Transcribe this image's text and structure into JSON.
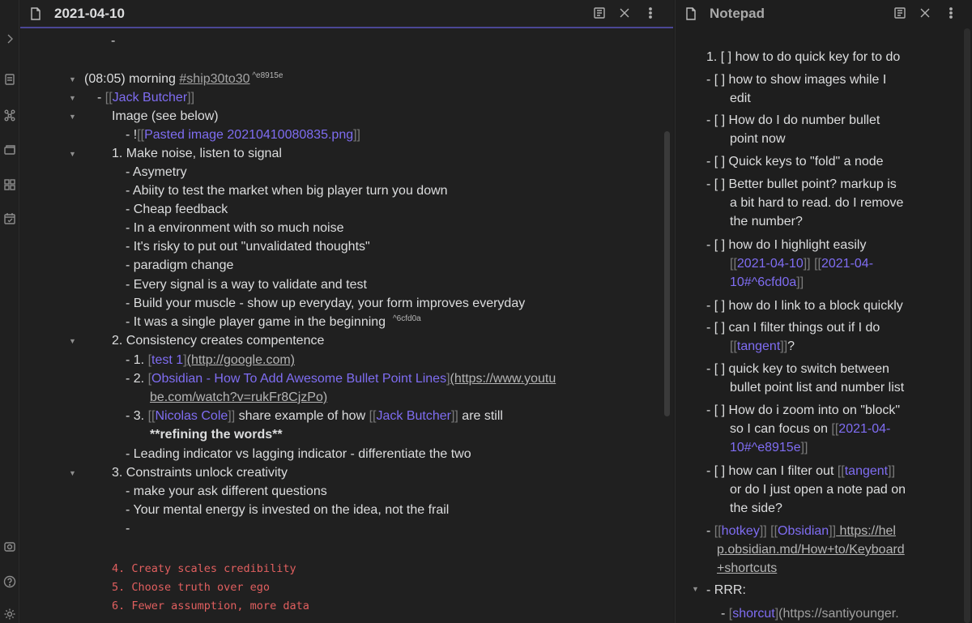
{
  "left_pane": {
    "title": "2021-04-10",
    "lines": {
      "l0": "-",
      "l1_time": "(08:05) morning ",
      "l1_tag": "#ship30to30",
      "l1_ref": " ^e8915e",
      "l2_dash": "- ",
      "l2_open": "[[",
      "l2_link": "Jack Butcher",
      "l2_close": "]]",
      "l3": "Image (see below)",
      "l4_pre": "- !",
      "l4_open": "[[",
      "l4_link": "Pasted image 20210410080835.png",
      "l4_close": "]]",
      "l5": "1. Make noise, listen to signal",
      "l6": "- Asymetry",
      "l7": "- Abiity to test the market when big player turn you down",
      "l8": "- Cheap feedback",
      "l9": "- In a environment with so much noise",
      "l10": "- It's risky to put out \"unvalidated thoughts\"",
      "l11": "- paradigm change",
      "l12": "- Every signal is a way to validate and test",
      "l13": "- Build your muscle - show up everyday, your form improves everyday",
      "l14": "- It was a single player game in the beginning",
      "l14_ref": "^6cfd0a",
      "l15": "2. Consistency creates compentence",
      "l16_pre": "- 1. ",
      "l16_open": "[",
      "l16_link": "test 1",
      "l16_close": "]",
      "l16_url": "(http://google.com)",
      "l17_pre": "- 2. ",
      "l17_open": "[",
      "l17_link": "Obsidian - How To Add Awesome Bullet Point Lines",
      "l17_close": "]",
      "l17_url1": "(https://www.youtu",
      "l17_url2": "be.com/watch?v=rukFr8CjzPo)",
      "l18_pre": "- 3. ",
      "l18_open1": "[[",
      "l18_link1": "Nicolas Cole",
      "l18_close1": "]]",
      "l18_mid": " share example of how ",
      "l18_open2": "[[",
      "l18_link2": "Jack Butcher",
      "l18_close2": "]]",
      "l18_end": " are still",
      "l19": "**refining the words**",
      "l20": "- Leading indicator vs lagging indicator - differentiate the two",
      "l21": "3. Constraints unlock creativity",
      "l22": "- make your ask different questions",
      "l23": "- Your mental energy is invested on the idea, not the frail",
      "l24": "-",
      "l25": "4. Creaty scales credibility",
      "l26": "5. Choose truth over ego",
      "l27": "6. Fewer assumption, more data"
    }
  },
  "right_pane": {
    "title": "Notepad",
    "items": {
      "r1": "1. [ ] how to do quick key for to do",
      "r2a": "- [ ] how to show images while I",
      "r2b": "edit",
      "r3a": "- [ ] How do I do number bullet",
      "r3b": "point now",
      "r4": "- [ ] Quick keys to \"fold\" a node",
      "r5a": "- [ ] Better bullet point? markup is",
      "r5b": "a bit hard to read. do I remove",
      "r5c": "the number?",
      "r6a": "- [ ] how do I highlight easily",
      "r6b_o1": "[[",
      "r6b_l1": "2021-04-10",
      "r6b_c1": "]]",
      "r6b_o2": " [[",
      "r6b_l2": "2021-04-",
      "r6c_l2": "10#^6cfd0a",
      "r6c_c2": "]]",
      "r7": "- [ ] how do I link to a block quickly",
      "r8a": "- [ ] can I filter things out if I do",
      "r8b_o": "[[",
      "r8b_l": "tangent",
      "r8b_c": "]]",
      "r8b_end": "?",
      "r9a": "- [ ] quick key to switch between",
      "r9b": "bullet point list and number list",
      "r10a": "- [ ] How do i zoom into on \"block\"",
      "r10b_pre": "so I can focus on ",
      "r10b_o": "[[",
      "r10b_l": "2021-04-",
      "r10c_l": "10#^e8915e",
      "r10c_c": "]]",
      "r11a_pre": "- [ ] how can I filter out ",
      "r11a_o": "[[",
      "r11a_l": "tangent",
      "r11a_c": "]]",
      "r11b": "or do I just open a note pad on",
      "r11c": "the side?",
      "r12_pre": "- ",
      "r12_o1": "[[",
      "r12_l1": "hotkey",
      "r12_c1": "]]",
      "r12_o2": " [[",
      "r12_l2": "Obsidian",
      "r12_c2": "]]",
      "r12_url1": " https://hel",
      "r12_url2": "p.obsidian.md/How+to/Keyboard",
      "r12_url3": "+shortcuts",
      "r13": "- RRR:",
      "r14_pre": "- ",
      "r14_o": "[",
      "r14_l": "shorcut",
      "r14_c": "]",
      "r14_url": "(https://santiyounger."
    }
  },
  "icons": [
    "chevron-right-icon",
    "open-switcher-icon",
    "graph-icon",
    "templates-icon",
    "calendar-grid-icon",
    "daily-note-icon",
    "vault-icon",
    "help-icon",
    "settings-icon",
    "file-icon",
    "reading-view-icon",
    "close-icon",
    "more-options-icon",
    "fold-arrow-icon"
  ],
  "colors": {
    "accent": "#7f6df2",
    "code_red": "#e15f5f",
    "background": "#202020"
  }
}
